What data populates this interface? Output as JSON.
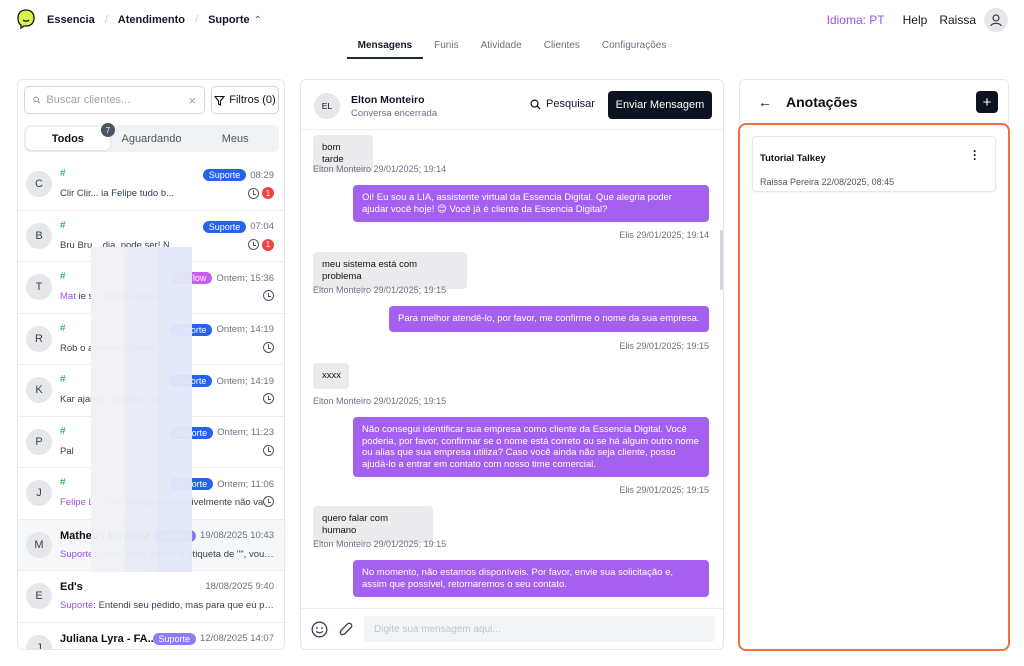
{
  "topbar": {
    "breadcrumb": [
      "Essencia",
      "Atendimento",
      "Suporte"
    ],
    "language": "Idioma: PT",
    "help": "Help",
    "user": "Raissa"
  },
  "nav_tabs": [
    {
      "label": "Mensagens",
      "active": true
    },
    {
      "label": "Funis",
      "active": false
    },
    {
      "label": "Atividade",
      "active": false
    },
    {
      "label": "Clientes",
      "active": false
    },
    {
      "label": "Configurações",
      "active": false
    }
  ],
  "left": {
    "search_placeholder": "Buscar clientes...",
    "filters_label": "Filtros (0)",
    "segments": [
      "Todos",
      "Aguardando",
      "Meus"
    ],
    "aguardando_count": "7",
    "contacts": [
      {
        "initial": "C",
        "name": "Clir",
        "hash": "#",
        "tag": "Suporte",
        "tag_color": "blue",
        "time": "08:29",
        "preview": "Clir... ia Felipe tudo b...",
        "who": "",
        "unread": "1"
      },
      {
        "initial": "B",
        "name": "Bru",
        "hash": "#",
        "tag": "Suporte",
        "tag_color": "blue",
        "time": "07:04",
        "preview": "Bru... dia, pode ser! N...",
        "who": "",
        "unread": "1"
      },
      {
        "initial": "T",
        "name": "Mat",
        "hash": "#",
        "tag": "esFlow",
        "tag_color": "purple",
        "time": "Ontem; 15:36",
        "preview": "ie ser algum delay n...",
        "who": "Mat",
        "unread": ""
      },
      {
        "initial": "R",
        "name": "Rob",
        "hash": "#",
        "tag": "Suporte",
        "tag_color": "blue",
        "time": "Ontem; 14:19",
        "preview": "o a gente exporta, ...",
        "who": "",
        "unread": ""
      },
      {
        "initial": "K",
        "name": "Kar",
        "hash": "#",
        "tag": "Suporte",
        "tag_color": "blue",
        "time": "Ontem; 14:19",
        "preview": "ajando...Beleza, obr...",
        "who": "",
        "unread": ""
      },
      {
        "initial": "P",
        "name": "Pal",
        "hash": "#",
        "tag": "Suporte",
        "tag_color": "blue",
        "time": "Ontem; 11:23",
        "preview": "",
        "who": "",
        "unread": ""
      },
      {
        "initial": "J",
        "name": "",
        "hash": "#",
        "tag": "Suporte",
        "tag_color": "blue",
        "time": "Ontem; 11:06",
        "preview": "só que ele possivelmente não vai ...",
        "who": "Felipe Lucena",
        "unread": ""
      },
      {
        "initial": "M",
        "name": "Matheus Miranda",
        "hash": "",
        "tag": "Suporte",
        "tag_color": "violet",
        "time": "19/08/2025 10:43",
        "preview": "Como você possui a etiqueta de \"\", vou enc...",
        "who": "Suporte",
        "unread": ""
      },
      {
        "initial": "E",
        "name": "Ed's",
        "hash": "",
        "tag": "",
        "tag_color": "",
        "time": "18/08/2025 9:40",
        "preview": "Entendi seu pedido, mas para que eu possa...",
        "who": "Suporte",
        "unread": ""
      },
      {
        "initial": "J",
        "name": "Juliana Lyra - FA...",
        "hash": "",
        "tag": "Suporte",
        "tag_color": "violet",
        "time": "12/08/2025 14:07",
        "preview": "",
        "who": "",
        "unread": ""
      }
    ]
  },
  "chat": {
    "avatar": "EL",
    "name": "Elton Monteiro",
    "status": "Conversa encerrada",
    "search_label": "Pesquisar",
    "send_label": "Enviar Mensagem",
    "input_placeholder": "Digite sua mensagem aqui...",
    "messages": [
      {
        "dir": "in",
        "text": "bom tarde",
        "meta": "Elton Monteiro 29/01/2025; 19:14"
      },
      {
        "dir": "out",
        "text": "Oi! Eu sou a LIA, assistente virtual da Essencia Digital. Que alegria poder ajudar você hoje! 😊 Você já é cliente da Essencia Digital?",
        "meta": "Elis 29/01/2025; 19:14"
      },
      {
        "dir": "in",
        "text": "meu sistema está com problema",
        "meta": "Elton Monteiro 29/01/2025; 19:15"
      },
      {
        "dir": "out",
        "text": "Para melhor atendê-lo, por favor, me confirme o nome da sua empresa.",
        "meta": "Elis 29/01/2025; 19:15"
      },
      {
        "dir": "in",
        "text": "xxxx",
        "meta": "Elton Monteiro 29/01/2025; 19:15"
      },
      {
        "dir": "out",
        "text": "Não consegui identificar sua empresa como cliente da Essencia Digital. Você poderia, por favor, confirmar se o nome está correto ou se há algum outro nome ou alias que sua empresa utiliza? Caso você ainda não seja cliente, posso ajudá-lo a entrar em contato com nosso time comercial.",
        "meta": "Elis 29/01/2025; 19:15"
      },
      {
        "dir": "in",
        "text": "quero falar com humano",
        "meta": "Elton Monteiro 29/01/2025; 19:15"
      },
      {
        "dir": "out",
        "text": "No momento, não estamos disponíveis. Por favor, envie sua solicitação e, assim que possível, retornaremos o seu contato.",
        "meta": ""
      }
    ]
  },
  "notes": {
    "title": "Anotações",
    "items": [
      {
        "title": "Tutorial Talkey",
        "meta": "Raissa Pereira 22/08/2025, 08:45"
      }
    ]
  },
  "colors": {
    "accent_purple": "#a560f0",
    "dark_button": "#0b1220",
    "tag_blue": "#2563eb",
    "highlight_orange": "#f0703f"
  }
}
